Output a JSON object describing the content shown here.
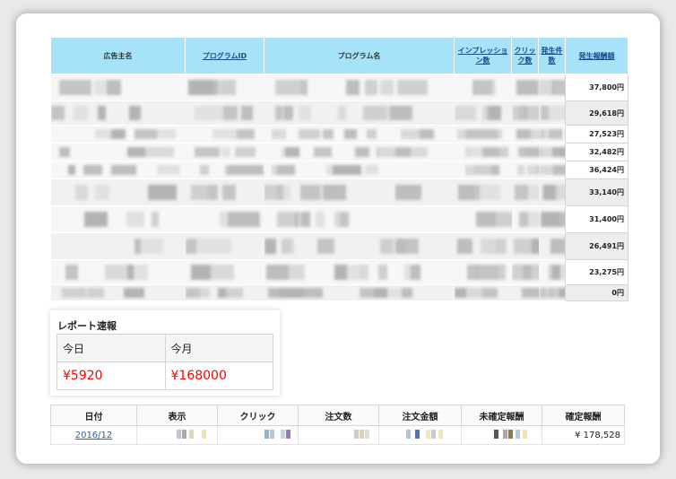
{
  "table": {
    "headers": {
      "advertiser": "広告主名",
      "program_id": "プログラムID",
      "program_name": "プログラム名",
      "impressions": "インプレッション数",
      "clicks": "クリック数",
      "occurrences": "発生件数",
      "reward": "発生報酬額"
    },
    "rewards": [
      "37,800円",
      "29,618円",
      "27,523円",
      "32,482円",
      "36,424円",
      "33,140円",
      "31,400円",
      "26,491円",
      "23,275円",
      "0円"
    ]
  },
  "report": {
    "title": "レポート速報",
    "today_label": "今日",
    "month_label": "今月",
    "today_value": "¥5920",
    "month_value": "¥168000"
  },
  "summary": {
    "headers": [
      "日付",
      "表示",
      "クリック",
      "注文数",
      "注文金額",
      "未確定報酬",
      "確定報酬"
    ],
    "date": "2016/12",
    "confirmed_reward": "¥ 178,528"
  }
}
